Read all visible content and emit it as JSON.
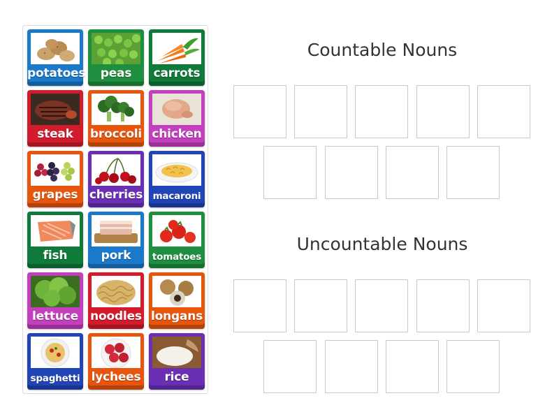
{
  "groups": [
    {
      "heading": "Countable Nouns"
    },
    {
      "heading": "Uncountable Nouns"
    }
  ],
  "colors": {
    "blue": "#1a79c9",
    "green": "#1d8f3e",
    "dark_green": "#0f7a3a",
    "red": "#d31b2c",
    "orange": "#e8550d",
    "magenta": "#c43fbd",
    "purple": "#6a2fb5",
    "navy": "#2144b7"
  },
  "cards": [
    {
      "label": "potatoes",
      "color": "blue",
      "icon": "potatoes-icon"
    },
    {
      "label": "peas",
      "color": "green",
      "icon": "peas-icon"
    },
    {
      "label": "carrots",
      "color": "dark_green",
      "icon": "carrots-icon"
    },
    {
      "label": "steak",
      "color": "red",
      "icon": "steak-icon"
    },
    {
      "label": "broccoli",
      "color": "orange",
      "icon": "broccoli-icon"
    },
    {
      "label": "chicken",
      "color": "magenta",
      "icon": "chicken-icon"
    },
    {
      "label": "grapes",
      "color": "orange",
      "icon": "grapes-icon"
    },
    {
      "label": "cherries",
      "color": "purple",
      "icon": "cherries-icon"
    },
    {
      "label": "macaroni",
      "color": "navy",
      "icon": "macaroni-icon"
    },
    {
      "label": "fish",
      "color": "dark_green",
      "icon": "fish-icon"
    },
    {
      "label": "pork",
      "color": "blue",
      "icon": "pork-icon"
    },
    {
      "label": "tomatoes",
      "color": "green",
      "icon": "tomatoes-icon"
    },
    {
      "label": "lettuce",
      "color": "magenta",
      "icon": "lettuce-icon"
    },
    {
      "label": "noodles",
      "color": "red",
      "icon": "noodles-icon"
    },
    {
      "label": "longans",
      "color": "orange",
      "icon": "longans-icon"
    },
    {
      "label": "spaghetti",
      "color": "navy",
      "icon": "spaghetti-icon"
    },
    {
      "label": "lychees",
      "color": "orange",
      "icon": "lychees-icon"
    },
    {
      "label": "rice",
      "color": "purple",
      "icon": "rice-icon"
    }
  ]
}
